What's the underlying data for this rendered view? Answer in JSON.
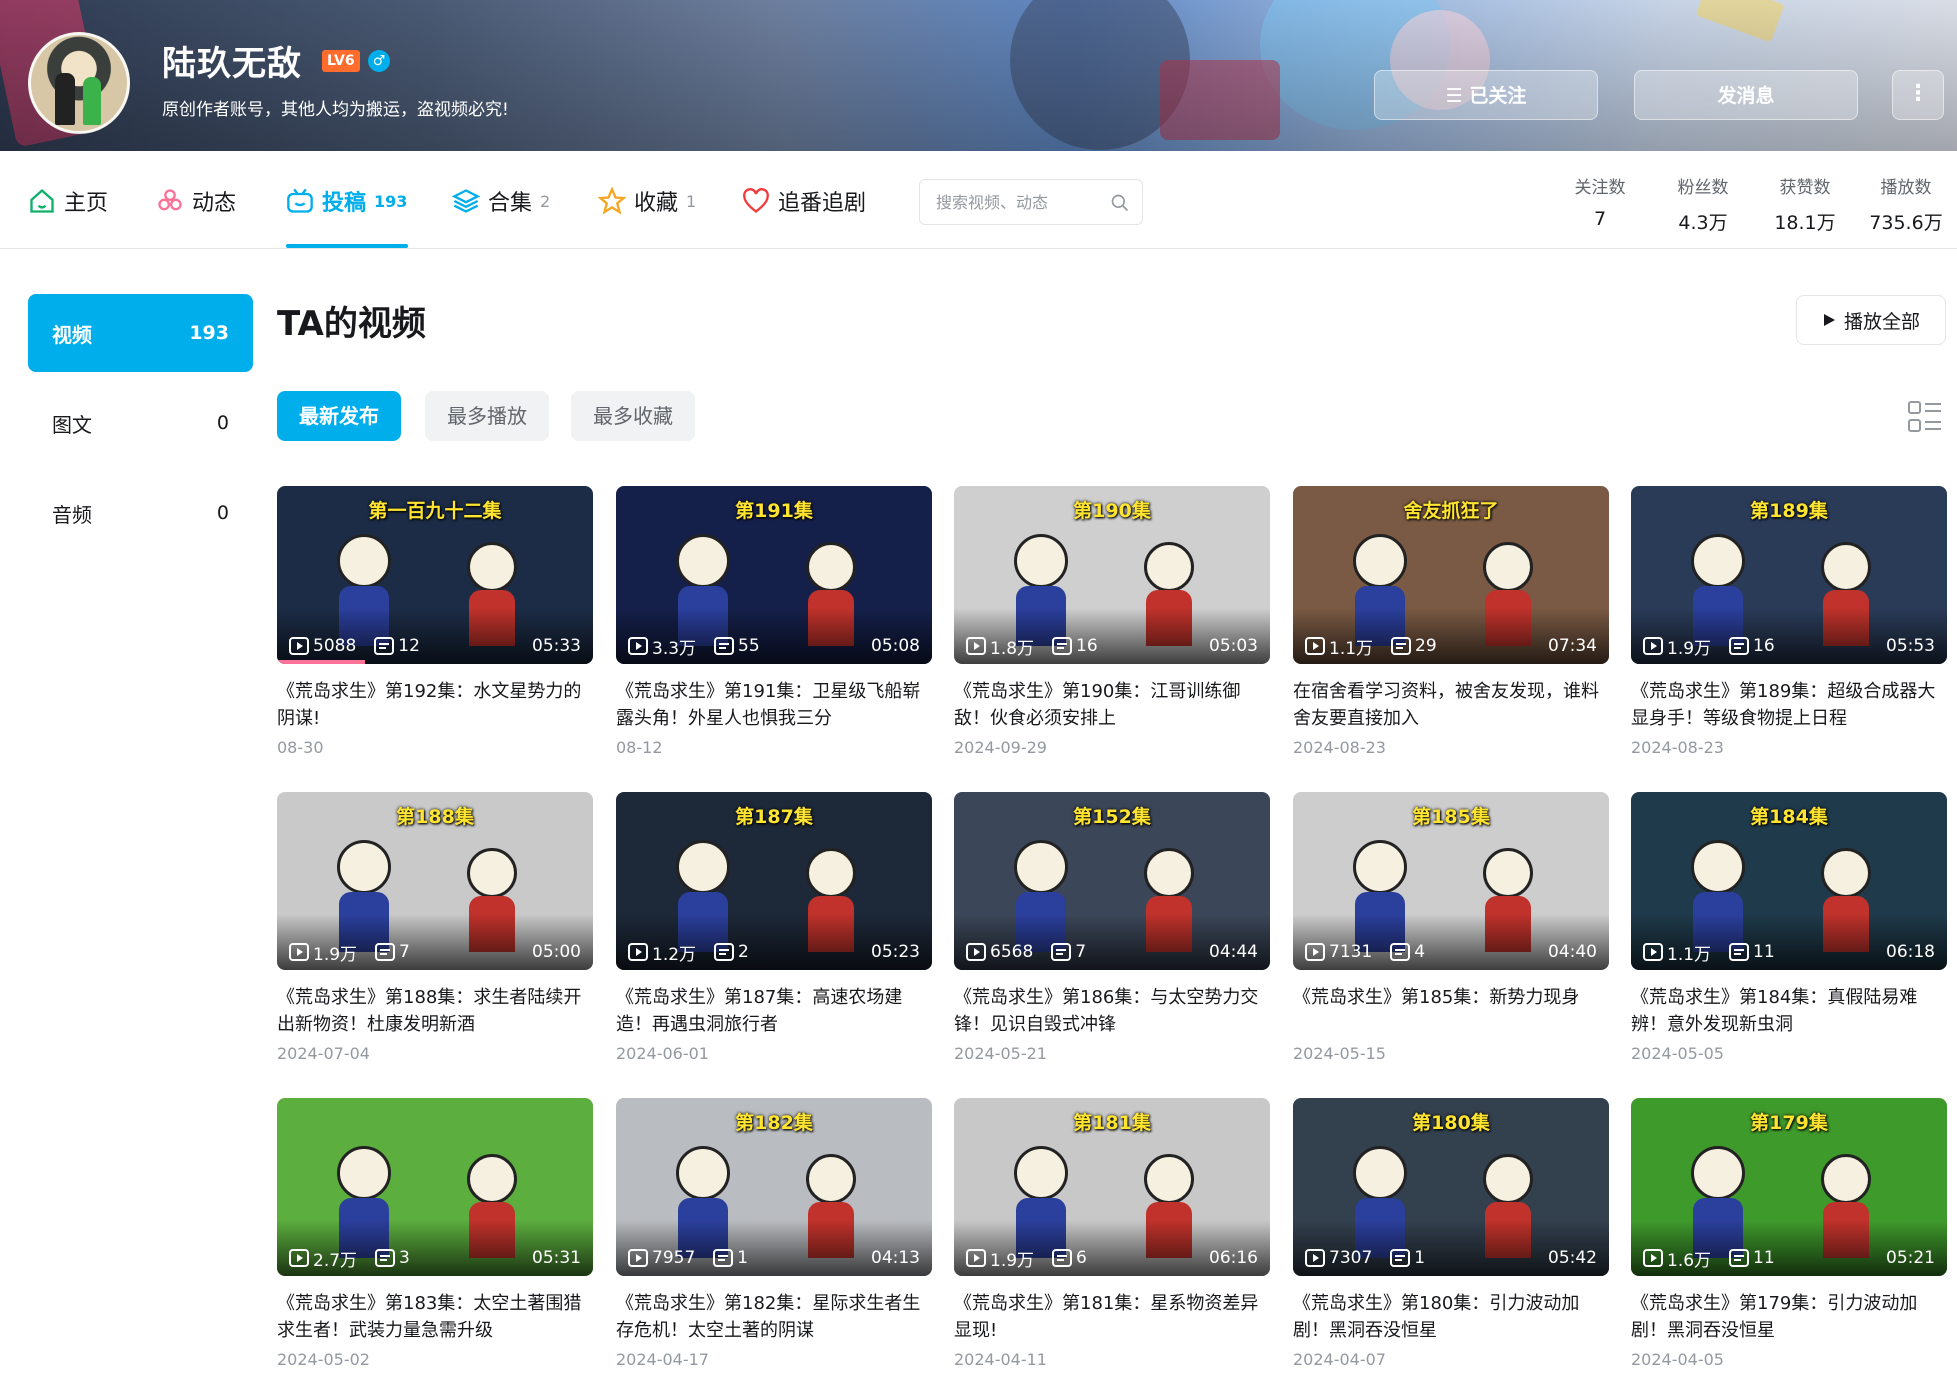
{
  "profile": {
    "name": "陆玖无敌",
    "level": "LV6",
    "gender": "♂",
    "sign": "原创作者账号，其他人均为搬运，盗视频必究!",
    "follow_label": "已关注",
    "message_label": "发消息",
    "more_label": "⋮"
  },
  "nav": {
    "home": "主页",
    "dynamic": "动态",
    "upload": "投稿",
    "upload_count": "193",
    "collections": "合集",
    "collections_count": "2",
    "favorites": "收藏",
    "favorites_count": "1",
    "bangumi": "追番追剧",
    "search_placeholder": "搜索视频、动态"
  },
  "stats": [
    {
      "label": "关注数",
      "value": "7"
    },
    {
      "label": "粉丝数",
      "value": "4.3万"
    },
    {
      "label": "获赞数",
      "value": "18.1万"
    },
    {
      "label": "播放数",
      "value": "735.6万"
    }
  ],
  "sidebar": [
    {
      "label": "视频",
      "count": "193"
    },
    {
      "label": "图文",
      "count": "0"
    },
    {
      "label": "音频",
      "count": "0"
    }
  ],
  "main": {
    "title": "TA的视频",
    "play_all": "播放全部",
    "filters": [
      "最新发布",
      "最多播放",
      "最多收藏"
    ]
  },
  "colors": {
    "accent": "#00aeec",
    "progress": "#fb7299"
  },
  "videos": [
    {
      "ep": "第一百九十二集",
      "views": "5088",
      "danmaku": "12",
      "duration": "05:33",
      "title": "《荒岛求生》第192集：水文星势力的阴谋!",
      "date": "08-30",
      "progress": 0.28,
      "bg": "#1c2c46"
    },
    {
      "ep": "第191集",
      "views": "3.3万",
      "danmaku": "55",
      "duration": "05:08",
      "title": "《荒岛求生》第191集：卫星级飞船崭露头角！外星人也惧我三分",
      "date": "08-12",
      "bg": "#15204a"
    },
    {
      "ep": "第190集",
      "views": "1.8万",
      "danmaku": "16",
      "duration": "05:03",
      "title": "《荒岛求生》第190集：江哥训练御敌！伙食必须安排上",
      "date": "2024-09-29",
      "bg": "#cfcfcf"
    },
    {
      "ep": "舍友抓狂了",
      "views": "1.1万",
      "danmaku": "29",
      "duration": "07:34",
      "title": "在宿舍看学习资料，被舍友发现，谁料舍友要直接加入",
      "date": "2024-08-23",
      "bg": "#7a5a44"
    },
    {
      "ep": "第189集",
      "views": "1.9万",
      "danmaku": "16",
      "duration": "05:53",
      "title": "《荒岛求生》第189集：超级合成器大显身手！等级食物提上日程",
      "date": "2024-08-23",
      "bg": "#2a3b58"
    },
    {
      "ep": "第188集",
      "views": "1.9万",
      "danmaku": "7",
      "duration": "05:00",
      "title": "《荒岛求生》第188集：求生者陆续开出新物资！杜康发明新酒",
      "date": "2024-07-04",
      "bg": "#c9c9c9"
    },
    {
      "ep": "第187集",
      "views": "1.2万",
      "danmaku": "2",
      "duration": "05:23",
      "title": "《荒岛求生》第187集：高速农场建造！再遇虫洞旅行者",
      "date": "2024-06-01",
      "bg": "#1d2838"
    },
    {
      "ep": "第152集",
      "views": "6568",
      "danmaku": "7",
      "duration": "04:44",
      "title": "《荒岛求生》第186集：与太空势力交锋！见识自毁式冲锋",
      "date": "2024-05-21",
      "bg": "#3b4658"
    },
    {
      "ep": "第185集",
      "views": "7131",
      "danmaku": "4",
      "duration": "04:40",
      "title": "《荒岛求生》第185集：新势力现身",
      "date": "2024-05-15",
      "bg": "#cdcdcd"
    },
    {
      "ep": "第184集",
      "views": "1.1万",
      "danmaku": "11",
      "duration": "06:18",
      "title": "《荒岛求生》第184集：真假陆易难辨！意外发现新虫洞",
      "date": "2024-05-05",
      "bg": "#1f3a4a"
    },
    {
      "ep": "",
      "views": "2.7万",
      "danmaku": "3",
      "duration": "05:31",
      "title": "《荒岛求生》第183集：太空土著围猎求生者！武装力量急需升级",
      "date": "2024-05-02",
      "bg": "#5cae3e"
    },
    {
      "ep": "第182集",
      "views": "7957",
      "danmaku": "1",
      "duration": "04:13",
      "title": "《荒岛求生》第182集：星际求生者生存危机！太空土著的阴谋",
      "date": "2024-04-17",
      "bg": "#b9bcc0"
    },
    {
      "ep": "第181集",
      "views": "1.9万",
      "danmaku": "6",
      "duration": "06:16",
      "title": "《荒岛求生》第181集：星系物资差异显现!",
      "date": "2024-04-11",
      "bg": "#c8c8c8"
    },
    {
      "ep": "第180集",
      "views": "7307",
      "danmaku": "1",
      "duration": "05:42",
      "title": "《荒岛求生》第180集：引力波动加剧！黑洞吞没恒星",
      "date": "2024-04-07",
      "bg": "#33404e"
    },
    {
      "ep": "第179集",
      "views": "1.6万",
      "danmaku": "11",
      "duration": "05:21",
      "title": "《荒岛求生》第179集：引力波动加剧！黑洞吞没恒星",
      "date": "2024-04-05",
      "bg": "#3f9a2c"
    }
  ]
}
